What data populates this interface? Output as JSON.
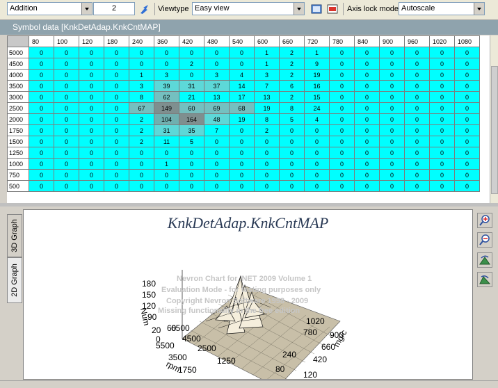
{
  "toolbar": {
    "mode_value": "Addition",
    "step_value": "2",
    "viewtype_label": "Viewtype",
    "viewtype_value": "Easy view",
    "axis_lock_label": "Axis lock mode",
    "axis_lock_value": "Autoscale"
  },
  "symbol": {
    "title": "Symbol data [KnkDetAdap.KnkCntMAP]"
  },
  "grid": {
    "columns": [
      "80",
      "100",
      "120",
      "180",
      "240",
      "360",
      "420",
      "480",
      "540",
      "600",
      "660",
      "720",
      "780",
      "840",
      "900",
      "960",
      "1020",
      "1080"
    ],
    "rows": [
      {
        "label": "5000",
        "values": [
          0,
          0,
          0,
          0,
          0,
          0,
          0,
          0,
          0,
          1,
          2,
          1,
          0,
          0,
          0,
          0,
          0,
          0
        ]
      },
      {
        "label": "4500",
        "values": [
          0,
          0,
          0,
          0,
          0,
          0,
          2,
          0,
          0,
          1,
          2,
          9,
          0,
          0,
          0,
          0,
          0,
          0
        ]
      },
      {
        "label": "4000",
        "values": [
          0,
          0,
          0,
          0,
          1,
          3,
          0,
          3,
          4,
          3,
          2,
          19,
          0,
          0,
          0,
          0,
          0,
          0
        ]
      },
      {
        "label": "3500",
        "values": [
          0,
          0,
          0,
          0,
          3,
          39,
          31,
          37,
          14,
          7,
          6,
          16,
          0,
          0,
          0,
          0,
          0,
          0
        ]
      },
      {
        "label": "3000",
        "values": [
          0,
          0,
          0,
          0,
          8,
          62,
          21,
          13,
          17,
          13,
          2,
          15,
          0,
          0,
          0,
          0,
          0,
          0
        ]
      },
      {
        "label": "2500",
        "values": [
          0,
          0,
          0,
          0,
          67,
          149,
          60,
          69,
          68,
          19,
          8,
          24,
          0,
          0,
          0,
          0,
          0,
          0
        ]
      },
      {
        "label": "2000",
        "values": [
          0,
          0,
          0,
          0,
          2,
          104,
          164,
          48,
          19,
          8,
          5,
          4,
          0,
          0,
          0,
          0,
          0,
          0
        ]
      },
      {
        "label": "1750",
        "values": [
          0,
          0,
          0,
          0,
          2,
          31,
          35,
          7,
          0,
          2,
          0,
          0,
          0,
          0,
          0,
          0,
          0,
          0
        ]
      },
      {
        "label": "1500",
        "values": [
          0,
          0,
          0,
          0,
          2,
          11,
          5,
          0,
          0,
          0,
          0,
          0,
          0,
          0,
          0,
          0,
          0,
          0
        ]
      },
      {
        "label": "1250",
        "values": [
          0,
          0,
          0,
          0,
          0,
          0,
          0,
          0,
          0,
          0,
          0,
          0,
          0,
          0,
          0,
          0,
          0,
          0
        ]
      },
      {
        "label": "1000",
        "values": [
          0,
          0,
          0,
          0,
          0,
          1,
          0,
          0,
          0,
          0,
          0,
          0,
          0,
          0,
          0,
          0,
          0,
          0
        ]
      },
      {
        "label": "750",
        "values": [
          0,
          0,
          0,
          0,
          0,
          0,
          0,
          0,
          0,
          0,
          0,
          0,
          0,
          0,
          0,
          0,
          0,
          0
        ]
      },
      {
        "label": "500",
        "values": [
          0,
          0,
          0,
          0,
          0,
          0,
          0,
          0,
          0,
          0,
          0,
          0,
          0,
          0,
          0,
          0,
          0,
          0
        ]
      }
    ],
    "cell_color": "#00ffff"
  },
  "tabs": {
    "tab_3d": "3D Graph",
    "tab_2d": "2D Graph"
  },
  "graph": {
    "title": "KnkDetAdap.KnkCntMAP",
    "z_axis_title": "Num",
    "z_ticks": [
      "180",
      "150",
      "120",
      "90",
      "60",
      "20",
      "0"
    ],
    "rpm_axis_title": "rpm",
    "rpm_ticks": [
      "6500",
      "4500",
      "5500",
      "2500",
      "3500",
      "1250",
      "1750"
    ],
    "mgc_axis_title": "mg/c",
    "mgc_ticks": [
      "1020",
      "780",
      "900",
      "660",
      "240",
      "420",
      "80",
      "120"
    ],
    "watermark": [
      "Nevron Chart for .NET 2009 Volume 1",
      "Evaluation Mode - for testing purposes only",
      "Copyright Nevron Software 1998 - 2009",
      "Missing functionality in the free edition"
    ]
  },
  "icons": [
    "graph-toggle-icon",
    "view-icon",
    "clear-icon",
    "zoom-in-icon",
    "zoom-out-icon",
    "rotate-left-icon",
    "rotate-right-icon"
  ]
}
